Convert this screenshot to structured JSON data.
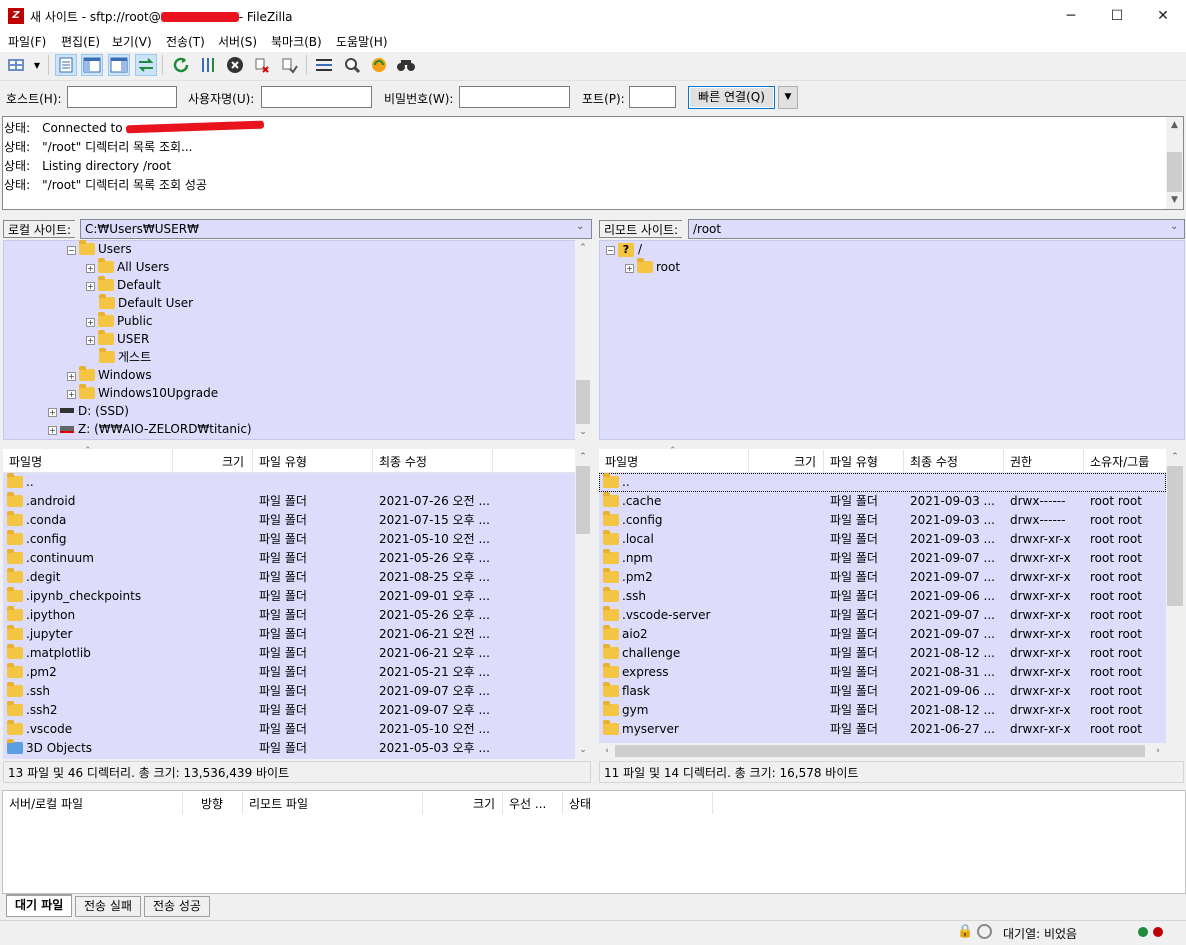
{
  "window": {
    "title_prefix": "새 사이트 - sftp://root@",
    "title_suffix": "- FileZilla",
    "minimize": "─",
    "maximize": "☐",
    "close": "✕"
  },
  "menu": [
    "파일(F)",
    "편집(E)",
    "보기(V)",
    "전송(T)",
    "서버(S)",
    "북마크(B)",
    "도움말(H)"
  ],
  "quickconnect": {
    "host_label": "호스트(H):",
    "user_label": "사용자명(U):",
    "pass_label": "비밀번호(W):",
    "port_label": "포트(P):",
    "connect_label": "빠른 연결(Q)",
    "host_value": "",
    "user_value": "",
    "pass_value": "",
    "port_value": ""
  },
  "log": [
    {
      "label": "상태:",
      "text": "Connected to "
    },
    {
      "label": "상태:",
      "text": "\"/root\" 디렉터리 목록 조회..."
    },
    {
      "label": "상태:",
      "text": "Listing directory /root"
    },
    {
      "label": "상태:",
      "text": "\"/root\" 디렉터리 목록 조회 성공"
    }
  ],
  "local": {
    "site_label": "로컬 사이트:",
    "path": "C:₩Users₩USER₩",
    "tree": [
      "Users",
      "All Users",
      "Default",
      "Default User",
      "Public",
      "USER",
      "게스트",
      "Windows",
      "Windows10Upgrade",
      "D: (SSD)",
      "Z: (₩₩AIO-ZELORD₩titanic)"
    ],
    "headers": [
      "파일명",
      "크기",
      "파일 유형",
      "최종 수정"
    ],
    "files": [
      {
        "name": "..",
        "size": "",
        "type": "",
        "modified": ""
      },
      {
        "name": ".android",
        "size": "",
        "type": "파일 폴더",
        "modified": "2021-07-26 오전 ..."
      },
      {
        "name": ".conda",
        "size": "",
        "type": "파일 폴더",
        "modified": "2021-07-15 오후 ..."
      },
      {
        "name": ".config",
        "size": "",
        "type": "파일 폴더",
        "modified": "2021-05-10 오전 ..."
      },
      {
        "name": ".continuum",
        "size": "",
        "type": "파일 폴더",
        "modified": "2021-05-26 오후 ..."
      },
      {
        "name": ".degit",
        "size": "",
        "type": "파일 폴더",
        "modified": "2021-08-25 오후 ..."
      },
      {
        "name": ".ipynb_checkpoints",
        "size": "",
        "type": "파일 폴더",
        "modified": "2021-09-01 오후 ..."
      },
      {
        "name": ".ipython",
        "size": "",
        "type": "파일 폴더",
        "modified": "2021-05-26 오후 ..."
      },
      {
        "name": ".jupyter",
        "size": "",
        "type": "파일 폴더",
        "modified": "2021-06-21 오전 ..."
      },
      {
        "name": ".matplotlib",
        "size": "",
        "type": "파일 폴더",
        "modified": "2021-06-21 오후 ..."
      },
      {
        "name": ".pm2",
        "size": "",
        "type": "파일 폴더",
        "modified": "2021-05-21 오후 ..."
      },
      {
        "name": ".ssh",
        "size": "",
        "type": "파일 폴더",
        "modified": "2021-09-07 오후 ..."
      },
      {
        "name": ".ssh2",
        "size": "",
        "type": "파일 폴더",
        "modified": "2021-09-07 오후 ..."
      },
      {
        "name": ".vscode",
        "size": "",
        "type": "파일 폴더",
        "modified": "2021-05-10 오전 ..."
      },
      {
        "name": "3D Objects",
        "size": "",
        "type": "파일 폴더",
        "modified": "2021-05-03 오후 ..."
      }
    ],
    "status": "13 파일 및 46 디렉터리. 총 크기: 13,536,439 바이트"
  },
  "remote": {
    "site_label": "리모트 사이트:",
    "path": "/root",
    "tree": [
      "/",
      "root"
    ],
    "headers": [
      "파일명",
      "크기",
      "파일 유형",
      "최종 수정",
      "권한",
      "소유자/그룹"
    ],
    "files": [
      {
        "name": "..",
        "type": "",
        "modified": "",
        "perm": "",
        "owner": ""
      },
      {
        "name": ".cache",
        "type": "파일 폴더",
        "modified": "2021-09-03 ...",
        "perm": "drwx------",
        "owner": "root root"
      },
      {
        "name": ".config",
        "type": "파일 폴더",
        "modified": "2021-09-03 ...",
        "perm": "drwx------",
        "owner": "root root"
      },
      {
        "name": ".local",
        "type": "파일 폴더",
        "modified": "2021-09-03 ...",
        "perm": "drwxr-xr-x",
        "owner": "root root"
      },
      {
        "name": ".npm",
        "type": "파일 폴더",
        "modified": "2021-09-07 ...",
        "perm": "drwxr-xr-x",
        "owner": "root root"
      },
      {
        "name": ".pm2",
        "type": "파일 폴더",
        "modified": "2021-09-07 ...",
        "perm": "drwxr-xr-x",
        "owner": "root root"
      },
      {
        "name": ".ssh",
        "type": "파일 폴더",
        "modified": "2021-09-06 ...",
        "perm": "drwxr-xr-x",
        "owner": "root root"
      },
      {
        "name": ".vscode-server",
        "type": "파일 폴더",
        "modified": "2021-09-07 ...",
        "perm": "drwxr-xr-x",
        "owner": "root root"
      },
      {
        "name": "aio2",
        "type": "파일 폴더",
        "modified": "2021-09-07 ...",
        "perm": "drwxr-xr-x",
        "owner": "root root"
      },
      {
        "name": "challenge",
        "type": "파일 폴더",
        "modified": "2021-08-12 ...",
        "perm": "drwxr-xr-x",
        "owner": "root root"
      },
      {
        "name": "express",
        "type": "파일 폴더",
        "modified": "2021-08-31 ...",
        "perm": "drwxr-xr-x",
        "owner": "root root"
      },
      {
        "name": "flask",
        "type": "파일 폴더",
        "modified": "2021-09-06 ...",
        "perm": "drwxr-xr-x",
        "owner": "root root"
      },
      {
        "name": "gym",
        "type": "파일 폴더",
        "modified": "2021-08-12 ...",
        "perm": "drwxr-xr-x",
        "owner": "root root"
      },
      {
        "name": "myserver",
        "type": "파일 폴더",
        "modified": "2021-06-27 ...",
        "perm": "drwxr-xr-x",
        "owner": "root root"
      }
    ],
    "status": "11 파일 및 14 디렉터리. 총 크기: 16,578 바이트"
  },
  "queue": {
    "headers": [
      "서버/로컬 파일",
      "방향",
      "리모트 파일",
      "크기",
      "우선 ...",
      "상태"
    ]
  },
  "tabs": [
    "대기 파일",
    "전송 실패",
    "전송 성공"
  ],
  "bottom": {
    "queue_status": "대기열: 비었음"
  },
  "colors": {
    "panel_bg": "#ddddfb",
    "accent": "#0078d7",
    "redaction": "#e8131d"
  }
}
